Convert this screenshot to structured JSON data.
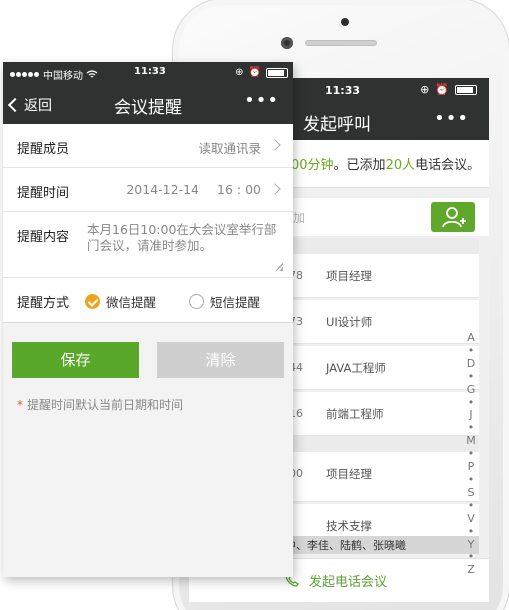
{
  "back_screen": {
    "status_time": "11:33",
    "title": "发起呼叫",
    "more": "•••",
    "notice": {
      "prefix": "00分钟。已添加",
      "count": "20人",
      "suffix": "电话会议。",
      "lead": "00分钟"
    },
    "search_placeholder": "加",
    "contacts": [
      {
        "num": "78",
        "role": "项目经理"
      },
      {
        "num": "73",
        "role": "UI设计师"
      },
      {
        "num": "44",
        "role": "JAVA工程师"
      },
      {
        "num": "16",
        "role": "前端工程师"
      },
      {
        "num": "00",
        "role": "项目经理"
      },
      {
        "num": "",
        "role": "技术支撑"
      }
    ],
    "alphabet": [
      "A",
      "•",
      "D",
      "•",
      "G",
      "•",
      "J",
      "•",
      "M",
      "•",
      "P",
      "•",
      "S",
      "•",
      "V",
      "•",
      "Y",
      "•",
      "Z"
    ],
    "selected_members": "中、李佳、陆鹤、张晓曦",
    "call_button": "发起电话会议"
  },
  "front_screen": {
    "status": {
      "carrier": "中国移动",
      "time": "11:33"
    },
    "back_label": "返回",
    "title": "会议提醒",
    "more": "•••",
    "rows": {
      "members": {
        "label": "提醒成员",
        "value": "读取通讯录"
      },
      "time": {
        "label": "提醒时间",
        "date": "2014-12-14",
        "clock": "16 : 00"
      },
      "content": {
        "label": "提醒内容",
        "value": "本月16日10:00在大会议室举行部门会议，请准时参加。"
      },
      "method": {
        "label": "提醒方式",
        "option1": "微信提醒",
        "option2": "短信提醒",
        "selected": "微信提醒"
      }
    },
    "save_button": "保存",
    "clear_button": "清除",
    "note_star": "*",
    "note": "提醒时间默认当前日期和时间"
  },
  "colors": {
    "accent_green": "#5aa82a",
    "highlight_green": "#6aab1e",
    "radio_orange": "#f0a31c",
    "dark_bar": "#2f3230"
  }
}
